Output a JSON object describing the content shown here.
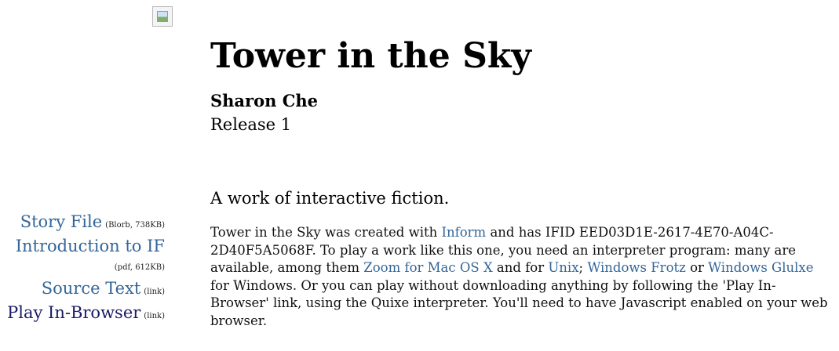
{
  "cover": {
    "icon": "broken-image-icon"
  },
  "title": "Tower in the Sky",
  "author": "Sharon Che",
  "release": "Release 1",
  "sidebar": {
    "story_file": {
      "label": "Story File",
      "meta": "(Blorb, 738KB)"
    },
    "intro": {
      "label": "Introduction to IF",
      "meta": "(pdf, 612KB)"
    },
    "source": {
      "label": "Source Text",
      "meta": "(link)"
    },
    "play": {
      "label": "Play In-Browser",
      "meta": "(link)"
    }
  },
  "tagline": "A work of interactive fiction.",
  "blurb": {
    "t1": "Tower in the Sky was created with ",
    "inform": "Inform",
    "t2": " and has IFID EED03D1E-2617-4E70-A04C-2D40F5A5068F. To play a work like this one, you need an interpreter program: many are available, among them ",
    "zoom": "Zoom for Mac OS X",
    "t3": " and for ",
    "unix": "Unix",
    "t4": "; ",
    "frotz": "Windows Frotz",
    "t5": " or ",
    "glulxe": "Windows Glulxe",
    "t6": " for Windows. Or you can play without downloading anything by following the 'Play In-Browser' link, using the Quixe interpreter. You'll need to have Javascript enabled on your web browser."
  },
  "colors": {
    "link": "#336699",
    "visited": "#1a1a66"
  }
}
